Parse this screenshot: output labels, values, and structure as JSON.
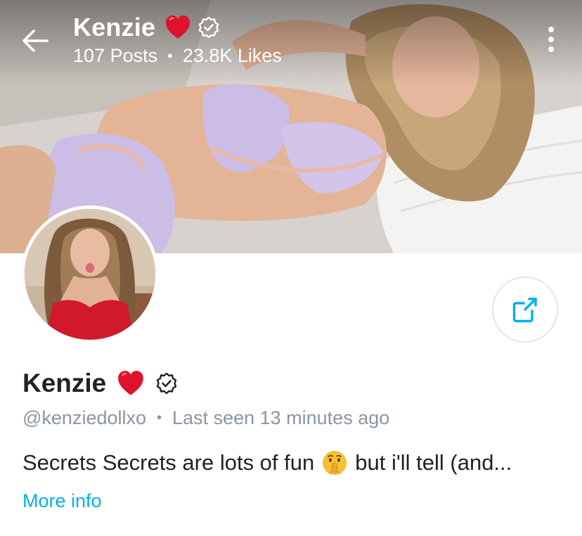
{
  "header": {
    "name": "Kenzie",
    "posts_count": "107",
    "posts_label": "Posts",
    "likes_count": "23.8K",
    "likes_label": "Likes",
    "separator": "•"
  },
  "profile": {
    "name": "Kenzie",
    "handle": "@kenziedollxo",
    "separator": "•",
    "last_seen": "Last seen 13 minutes ago",
    "bio_before_emoji": "Secrets Secrets are lots of fun",
    "bio_after_emoji": "but i'll tell (and...",
    "more_info_label": "More info"
  },
  "icons": {
    "back": "back-arrow-icon",
    "more": "more-vertical-icon",
    "heart": "red-heart-icon",
    "verified": "verified-badge-icon",
    "share": "share-icon",
    "shush": "shushing-face-emoji"
  },
  "colors": {
    "accent": "#00aff0",
    "text_primary": "#222222",
    "text_secondary": "#8a96a3",
    "heart": "#e0112b",
    "border": "#e3e6ea"
  }
}
